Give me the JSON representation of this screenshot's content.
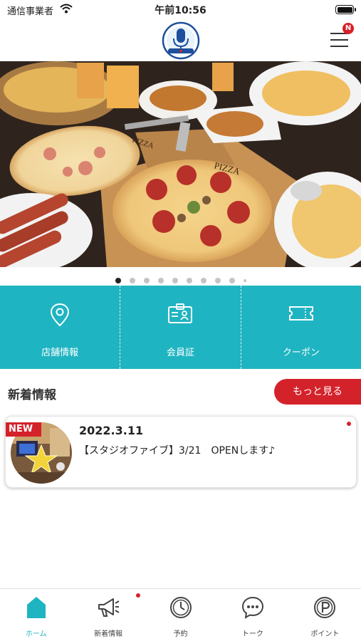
{
  "status_bar": {
    "carrier": "通信事業者",
    "time": "午前10:56"
  },
  "header": {
    "menu_badge": "N",
    "logo_icon": "microphone-logo-icon"
  },
  "hero": {
    "image_description_icon": "pizza-photo",
    "pizza_board_text_1": "PIZZA",
    "pizza_board_text_2": "PIZZA",
    "slide_count": 10,
    "active_slide": 1
  },
  "quick_menu": [
    {
      "label": "店舗情報",
      "icon": "map-pin-icon"
    },
    {
      "label": "会員証",
      "icon": "member-card-icon"
    },
    {
      "label": "クーポン",
      "icon": "coupon-icon"
    }
  ],
  "news": {
    "heading": "新着情報",
    "more_label": "もっと見る",
    "items": [
      {
        "badge": "NEW",
        "date": "2022.3.11",
        "title": "【スタジオファイブ】3/21　OPENします♪"
      }
    ]
  },
  "tab_bar": [
    {
      "label": "ホーム",
      "icon": "home-icon",
      "active": true
    },
    {
      "label": "新着情報",
      "icon": "megaphone-icon",
      "active": false
    },
    {
      "label": "予約",
      "icon": "clock-icon",
      "active": false
    },
    {
      "label": "トーク",
      "icon": "chat-bubble-icon",
      "active": false
    },
    {
      "label": "ポイント",
      "icon": "points-icon",
      "active": false
    }
  ],
  "colors": {
    "accent": "#1fb4c1",
    "brand_red": "#d4222b"
  }
}
